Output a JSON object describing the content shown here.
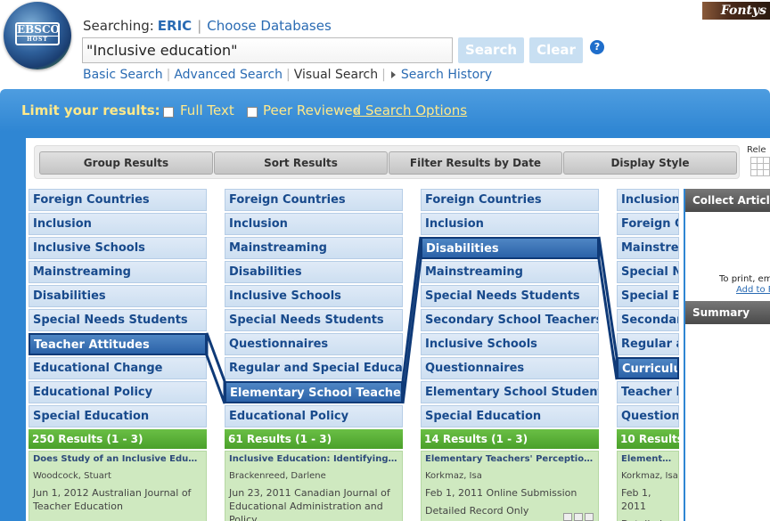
{
  "header": {
    "searching_label": "Searching:",
    "database": "ERIC",
    "choose_databases": "Choose Databases",
    "search_value": "\"Inclusive education\"",
    "search_button": "Search",
    "clear_button": "Clear",
    "help_glyph": "?",
    "logo_line1": "EBSCO",
    "logo_line2": "HOST",
    "brand": "Fontys"
  },
  "nav_links": {
    "basic": "Basic Search",
    "advanced": "Advanced Search",
    "visual": "Visual Search",
    "history": "Search History"
  },
  "limits": {
    "label": "Limit your results:",
    "full_text": "Full Text",
    "peer_reviewed": "Peer Reviewed",
    "search_options": "« Search Options"
  },
  "toolbar": {
    "group": "Group Results",
    "sort": "Sort Results",
    "filter": "Filter Results by Date",
    "display": "Display Style",
    "relevance": "Rele"
  },
  "columns": [
    {
      "items": [
        "Foreign Countries",
        "Inclusion",
        "Inclusive Schools",
        "Mainstreaming",
        "Disabilities",
        "Special Needs Students",
        "Teacher Attitudes",
        "Educational Change",
        "Educational Policy",
        "Special Education"
      ],
      "selected": 6,
      "results": "250 Results (1 - 3)",
      "card": {
        "title": "Does Study of an Inclusive Education Su...",
        "author": "Woodcock, Stuart",
        "source": "Jun 1, 2012 Australian Journal of Teacher Education",
        "detail": ""
      }
    },
    {
      "items": [
        "Foreign Countries",
        "Inclusion",
        "Mainstreaming",
        "Disabilities",
        "Inclusive Schools",
        "Special Needs Students",
        "Questionnaires",
        "Regular and Special Education ...",
        "Elementary School Teachers",
        "Educational Policy"
      ],
      "selected": 8,
      "results": "61 Results (1 - 3)",
      "card": {
        "title": "Inclusive Education: Identifying Teacher...",
        "author": "Brackenreed, Darlene",
        "source": "Jun 23, 2011 Canadian Journal of Educational Administration and Policy",
        "detail": ""
      }
    },
    {
      "items": [
        "Foreign Countries",
        "Inclusion",
        "Disabilities",
        "Mainstreaming",
        "Special Needs Students",
        "Secondary School Teachers",
        "Inclusive Schools",
        "Questionnaires",
        "Elementary School Students",
        "Special Education"
      ],
      "selected": 2,
      "results": "14 Results (1 - 3)",
      "card": {
        "title": "Elementary Teachers' Perceptions abou...",
        "author": "Korkmaz, Isa",
        "source": "Feb 1, 2011 Online Submission",
        "detail": "Detailed Record Only"
      }
    },
    {
      "items": [
        "Inclusion",
        "Foreign Co",
        "Mainstrean",
        "Special Nee",
        "Special Edu",
        "Secondary",
        "Regular and",
        "Curriculum",
        "Teacher Eff",
        "Questionna"
      ],
      "selected": 7,
      "results": "10 Results (",
      "card": {
        "title": "Elementary Te",
        "author": "Korkmaz, Isa",
        "source": "Feb 1, 2011",
        "detail": "Detailed Rec"
      }
    }
  ],
  "collect": {
    "title": "Collect Articles",
    "print_text": "To print, email",
    "add_link": "Add to Fo",
    "summary": "Summary"
  }
}
